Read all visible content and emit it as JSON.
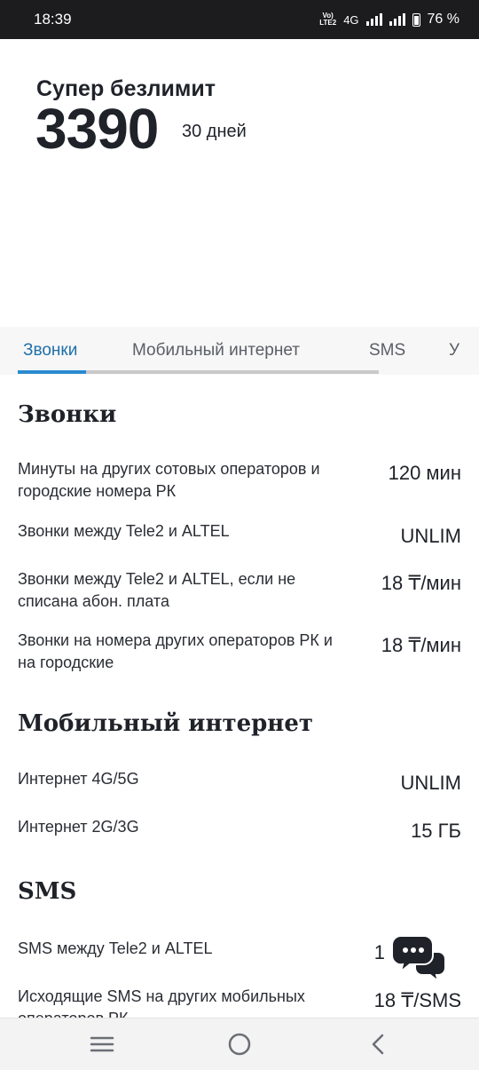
{
  "status_bar": {
    "time": "18:39",
    "volte_top": "Vo)",
    "volte_bottom": "LTE2",
    "network": "4G",
    "battery_percent": "76 %"
  },
  "plan": {
    "name": "Супер безлимит",
    "price": "3390",
    "period": "30 дней"
  },
  "tabs": [
    {
      "label": "Звонки",
      "active": true
    },
    {
      "label": "Мобильный интернет",
      "active": false
    },
    {
      "label": "SMS",
      "active": false
    },
    {
      "label": "У",
      "active": false
    }
  ],
  "sections": {
    "calls": {
      "title": "Звонки",
      "rows": [
        {
          "label": "Минуты на других сотовых операторов и городские номера РК",
          "value": "120 мин"
        },
        {
          "label": "Звонки между Tele2 и ALTEL",
          "value": "UNLIM"
        },
        {
          "label": "Звонки между Tele2 и ALTEL, если не списана абон. плата",
          "value": "18 ₸/мин"
        },
        {
          "label": "Звонки на номера других операторов РК и на городские",
          "value": "18 ₸/мин"
        }
      ]
    },
    "internet": {
      "title": "Мобильный интернет",
      "rows": [
        {
          "label": "Интернет 4G/5G",
          "value": "UNLIM"
        },
        {
          "label": "Интернет 2G/3G",
          "value": "15 ГБ"
        }
      ]
    },
    "sms": {
      "title": "SMS",
      "rows": [
        {
          "label": "SMS между Tele2 и ALTEL",
          "value": "1"
        },
        {
          "label": "Исходящие SMS на других мобильных операторов РК",
          "value": "18 ₸/SMS"
        }
      ]
    }
  },
  "icons": {
    "chat": "chat-bubbles-icon",
    "nav_recent": "recent-apps-icon",
    "nav_home": "home-circle-icon",
    "nav_back": "back-chevron-icon"
  },
  "colors": {
    "accent": "#2a8bd1",
    "active_tab_text": "#1f6fa8",
    "text": "#1f2229"
  }
}
